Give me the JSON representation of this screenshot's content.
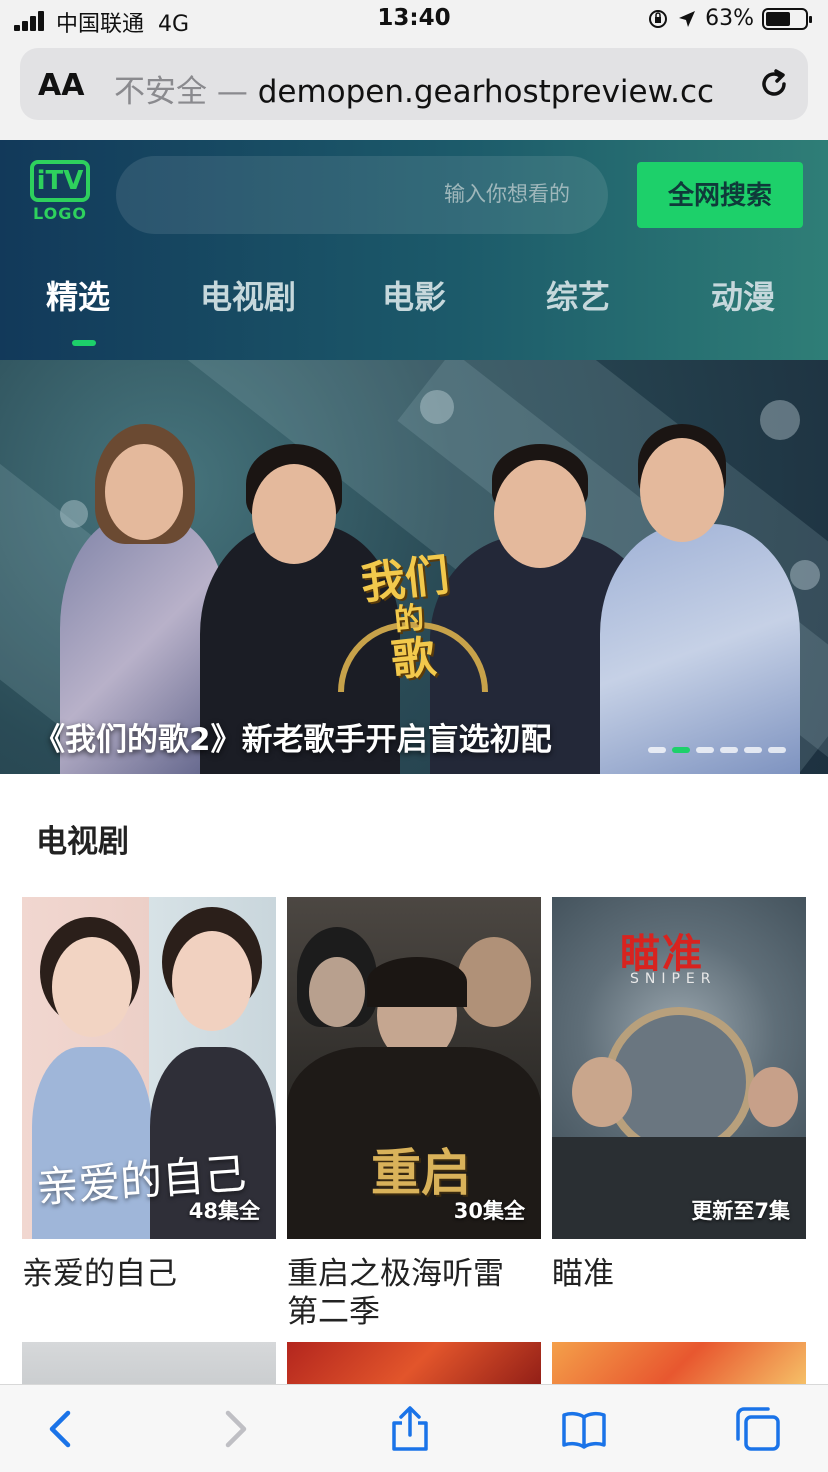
{
  "status_bar": {
    "carrier": "中国联通",
    "network": "4G",
    "time": "13:40",
    "battery": "63%",
    "battery_level": 0.63
  },
  "browser": {
    "text_size_button": "AA",
    "url_insecure_label": "不安全 —",
    "url_host": "demopen.gearhostpreview.cc",
    "reload_icon": "reload-icon"
  },
  "header": {
    "logo_badge": "TV",
    "logo_word": "LOGO",
    "search_placeholder": "输入你想看的",
    "search_button": "全网搜索"
  },
  "nav": {
    "tabs": [
      {
        "label": "精选",
        "active": true
      },
      {
        "label": "电视剧",
        "active": false
      },
      {
        "label": "电影",
        "active": false
      },
      {
        "label": "综艺",
        "active": false
      },
      {
        "label": "动漫",
        "active": false
      }
    ]
  },
  "banner": {
    "caption": "《我们的歌2》新老歌手开启盲选初配",
    "show_logo_lines": [
      "我们",
      "的",
      "歌"
    ],
    "dot_count": 6,
    "active_dot": 1
  },
  "section": {
    "title": "电视剧",
    "cards": [
      {
        "title": "亲爱的自己",
        "episodes": "48集全",
        "poster_text": "亲爱的自己"
      },
      {
        "title": "重启之极海听雷 第二季",
        "episodes": "30集全",
        "poster_text": "重启"
      },
      {
        "title": "瞄准",
        "episodes": "更新至7集",
        "poster_text": "瞄准",
        "poster_subtext": "SNIPER"
      }
    ]
  },
  "toolbar": {
    "icons": [
      "back-icon",
      "forward-icon",
      "share-icon",
      "bookmarks-icon",
      "tabs-icon"
    ]
  },
  "colors": {
    "accent": "#1dd06a",
    "header_gradient_start": "#12395a",
    "header_gradient_end": "#2f7e77",
    "ios_blue": "#1a73e8"
  }
}
